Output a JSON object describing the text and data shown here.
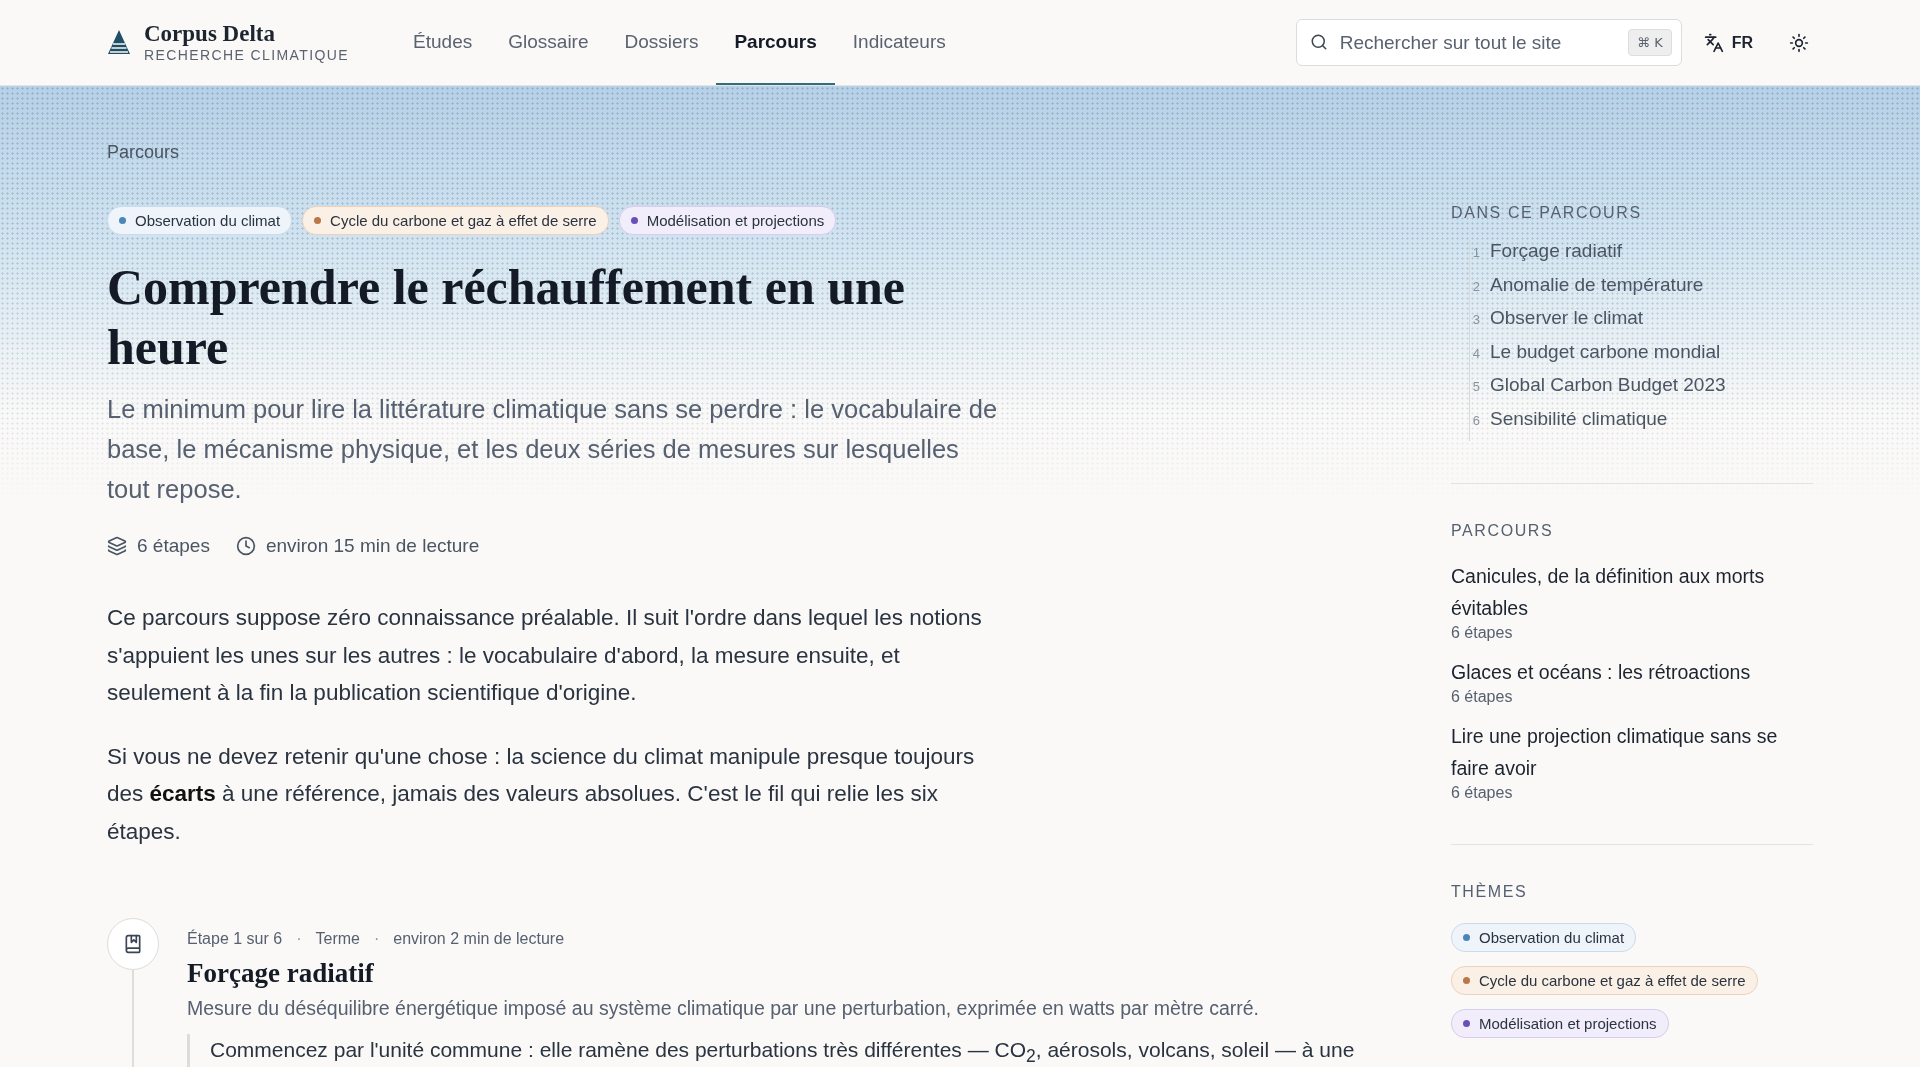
{
  "brand": {
    "name": "Corpus Delta",
    "tagline": "RECHERCHE CLIMATIQUE"
  },
  "nav": [
    {
      "label": "Études",
      "selected": false
    },
    {
      "label": "Glossaire",
      "selected": false
    },
    {
      "label": "Dossiers",
      "selected": false
    },
    {
      "label": "Parcours",
      "selected": true
    },
    {
      "label": "Indicateurs",
      "selected": false
    }
  ],
  "search": {
    "placeholder": "Rechercher sur tout le site",
    "shortcut": "⌘ K"
  },
  "language": "FR",
  "breadcrumb": "Parcours",
  "tags": [
    {
      "label": "Observation du climat",
      "color": "#4a86b8"
    },
    {
      "label": "Cycle du carbone et gaz à effet de serre",
      "color": "#b9774a"
    },
    {
      "label": "Modélisation et projections",
      "color": "#6b4fb8"
    }
  ],
  "title": "Comprendre le réchauffement en une heure",
  "lead": "Le minimum pour lire la littérature climatique sans se perdre : le vocabulaire de base, le mécanisme physique, et les deux séries de mesures sur lesquelles tout repose.",
  "meta": {
    "steps": "6 étapes",
    "reading": "environ 15 min de lecture"
  },
  "paragraphs": [
    "Ce parcours suppose zéro connaissance préalable. Il suit l'ordre dans lequel les notions s'appuient les unes sur les autres : le vocabulaire d'abord, la mesure ensuite, et seulement à la fin la publication scientifique d'origine.",
    "Si vous ne devez retenir qu'une chose : la science du climat manipule presque toujours des **écarts** à une référence, jamais des valeurs absolues. C'est le fil qui relie les six étapes."
  ],
  "steps": [
    {
      "position": "Étape 1 sur 6",
      "separator": "·",
      "type": "Terme",
      "reading": "environ 2 min de lecture",
      "title": "Forçage radiatif",
      "summary": "Mesure du déséquilibre énergétique imposé au système climatique par une perturbation, exprimée en watts par mètre carré.",
      "quote": "Commencez par l'unité commune : elle ramène des perturbations très différentes — CO$_{2}$, aérosols, volcans, soleil — à une"
    }
  ],
  "sidebar": {
    "toc_title": "DANS CE PARCOURS",
    "toc": [
      {
        "number": "1",
        "label": "Forçage radiatif"
      },
      {
        "number": "2",
        "label": "Anomalie de température"
      },
      {
        "number": "3",
        "label": "Observer le climat"
      },
      {
        "number": "4",
        "label": "Le budget carbone mondial"
      },
      {
        "number": "5",
        "label": "Global Carbon Budget 2023"
      },
      {
        "number": "6",
        "label": "Sensibilité climatique"
      }
    ],
    "paths_title": "PARCOURS",
    "paths": [
      {
        "title": "Canicules, de la définition aux morts évitables",
        "count": "6 étapes"
      },
      {
        "title": "Glaces et océans : les rétroactions",
        "count": "6 étapes"
      },
      {
        "title": "Lire une projection climatique sans se faire avoir",
        "count": "6 étapes"
      }
    ],
    "themes_title": "THÈMES",
    "themes": [
      {
        "label": "Observation du climat",
        "color": "#4a86b8"
      },
      {
        "label": "Cycle du carbone et gaz à effet de serre",
        "color": "#b9774a"
      },
      {
        "label": "Modélisation et projections",
        "color": "#6b4fb8"
      }
    ]
  }
}
